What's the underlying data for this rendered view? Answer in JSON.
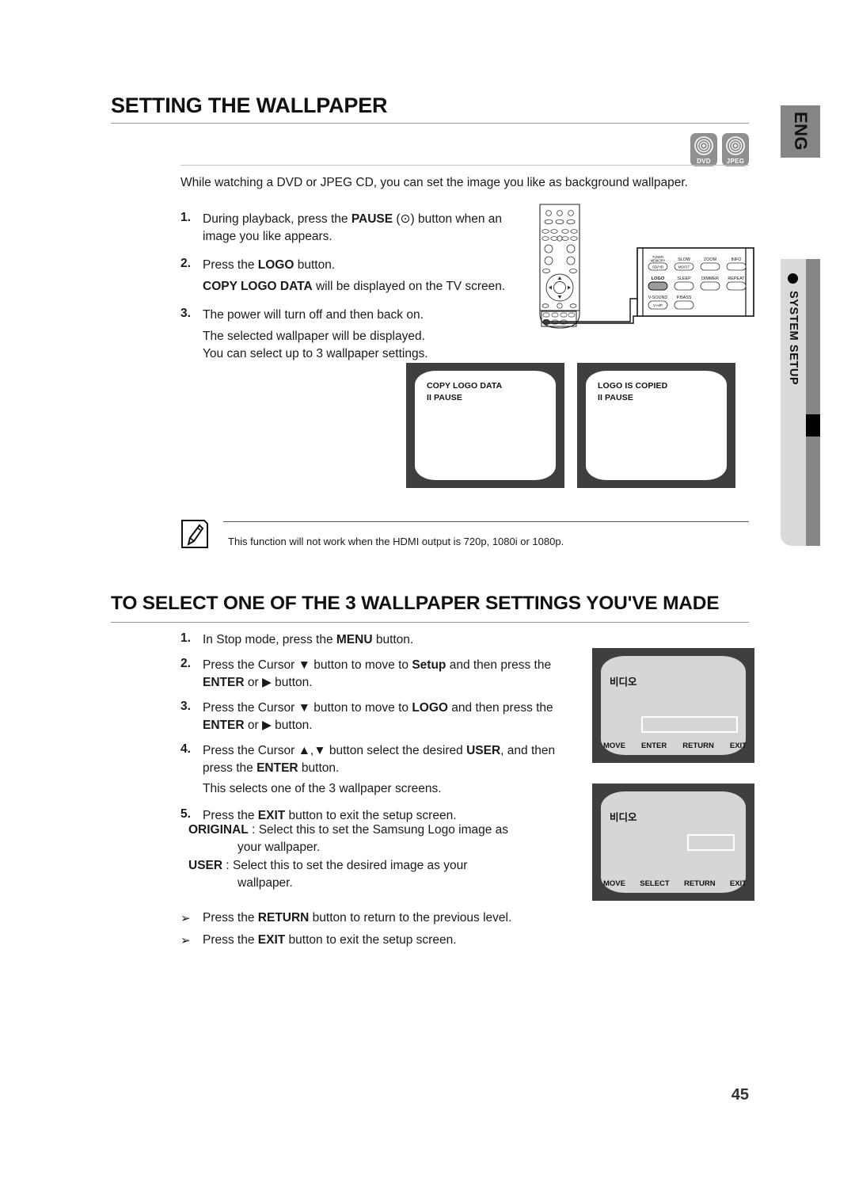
{
  "sidebar": {
    "language_badge": "ENG",
    "tab_label": "SYSTEM SETUP",
    "bullet": "bullet-dot"
  },
  "section1": {
    "title": "SETTING THE WALLPAPER",
    "media_badges": [
      {
        "icon": "disc-icon",
        "label": "DVD"
      },
      {
        "icon": "disc-icon",
        "label": "JPEG"
      }
    ],
    "intro": "While watching a DVD or JPEG CD, you can set the image you like as background wallpaper.",
    "steps": [
      {
        "num": "1.",
        "text_a": "During playback, press the ",
        "bold_a": "PAUSE",
        "text_b": " (⊙) button when an image you like appears."
      },
      {
        "num": "2.",
        "text_a": "Press the ",
        "bold_a": "LOGO",
        "text_b": " button.",
        "sub_bold": "COPY LOGO DATA",
        "sub_text": " will be displayed on the TV screen."
      },
      {
        "num": "3.",
        "text_a": "The power will turn off and then back on.",
        "bold_a": "",
        "text_b": "",
        "sub_lines": [
          "The selected wallpaper will be displayed.",
          "You can select up to 3 wallpaper settings."
        ]
      }
    ],
    "tv_screens": [
      {
        "line1": "COPY LOGO DATA",
        "line2": "II PAUSE"
      },
      {
        "line1": "LOGO IS COPIED",
        "line2": "II PAUSE"
      }
    ],
    "remote": {
      "buttons_row1": [
        {
          "caption": "TUNER\nMEMORY",
          "label": "SD/HD"
        },
        {
          "caption": "SLOW",
          "label": "MO/ST"
        },
        {
          "caption": "ZOOM",
          "label": ""
        },
        {
          "caption": "INFO",
          "label": ""
        }
      ],
      "buttons_row2": [
        {
          "caption": "LOGO",
          "label": "",
          "highlight": true
        },
        {
          "caption": "SLEEP",
          "label": ""
        },
        {
          "caption": "DIMMER",
          "label": ""
        },
        {
          "caption": "REPEAT",
          "label": ""
        }
      ],
      "buttons_row3": [
        {
          "caption": "V-SOUND",
          "label": "V-H/P"
        },
        {
          "caption": "P.BASS",
          "label": ""
        }
      ]
    },
    "note": {
      "icon": "note-pencil-icon",
      "text": "This function will not work when the HDMI output is 720p, 1080i or 1080p."
    }
  },
  "section2": {
    "title": "TO SELECT ONE OF THE 3 WALLPAPER SETTINGS YOU'VE MADE",
    "steps": [
      {
        "num": "1.",
        "parts": [
          "In Stop mode, press the ",
          "MENU",
          " button."
        ]
      },
      {
        "num": "2.",
        "parts": [
          "Press the Cursor ▼ button to move to ",
          "Setup",
          " and then press the "
        ],
        "parts2": [
          "ENTER",
          " or ▶ button."
        ]
      },
      {
        "num": "3.",
        "parts": [
          "Press the Cursor ▼ button to move to ",
          "LOGO",
          " and then press the "
        ],
        "parts2": [
          "ENTER",
          " or ▶ button."
        ]
      },
      {
        "num": "4.",
        "parts": [
          "Press the Cursor ▲,▼ button select the desired ",
          "USER",
          ", and then press the "
        ],
        "parts2": [
          "ENTER",
          " button."
        ],
        "sub": "This selects one of the 3 wallpaper screens."
      },
      {
        "num": "5.",
        "parts": [
          "Press the ",
          "EXIT",
          " button to exit the setup screen."
        ]
      }
    ],
    "definitions": [
      {
        "term": "ORIGINAL",
        "sep": " : ",
        "text": "Select this to set the Samsung Logo image as",
        "cont": "your wallpaper."
      },
      {
        "term": "USER",
        "sep": " : ",
        "text": "Select this to set the desired image as your",
        "cont": "wallpaper."
      }
    ],
    "arrow_notes": [
      {
        "glyph": "➢",
        "text_a": "Press the ",
        "bold": "RETURN",
        "text_b": " button to return to the previous level."
      },
      {
        "glyph": "➢",
        "text_a": "Press the ",
        "bold": "EXIT",
        "text_b": " button to exit the setup screen."
      }
    ],
    "menu_screens": [
      {
        "title_kr": "비디오",
        "footer": [
          "MOVE",
          "ENTER",
          "RETURN",
          "EXIT"
        ]
      },
      {
        "title_kr": "비디오",
        "footer": [
          "MOVE",
          "SELECT",
          "RETURN",
          "EXIT"
        ]
      }
    ]
  },
  "footer": {
    "page_number": "45"
  },
  "colors": {
    "tab_light": "#d9d9d9",
    "tab_dark": "#868686",
    "tv_bezel": "#3f3f3f",
    "osd_bg": "#d6d6d6"
  }
}
